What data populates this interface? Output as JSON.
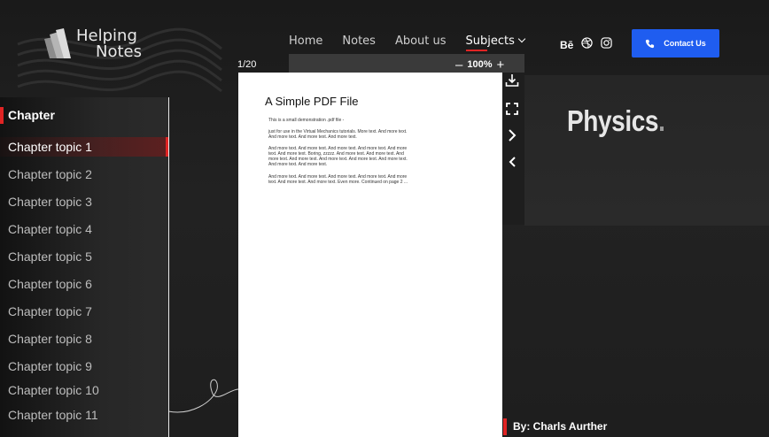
{
  "logo": {
    "line1": "Helping",
    "line2": "Notes"
  },
  "nav": {
    "items": [
      {
        "label": "Home"
      },
      {
        "label": "Notes"
      },
      {
        "label": "About us"
      },
      {
        "label": "Subjects"
      }
    ]
  },
  "social": {
    "behance": "Bē",
    "icons": [
      "behance-icon",
      "dribbble-icon",
      "instagram-icon"
    ]
  },
  "contact": {
    "label": "Contact Us"
  },
  "sidebar": {
    "title": "Chapter",
    "items": [
      {
        "label": "Chapter topic 1"
      },
      {
        "label": "Chapter topic 2"
      },
      {
        "label": "Chapter topic 3"
      },
      {
        "label": "Chapter topic 4"
      },
      {
        "label": "Chapter topic 5"
      },
      {
        "label": "Chapter topic 6"
      },
      {
        "label": "Chapter topic 7"
      },
      {
        "label": "Chapter topic 8"
      },
      {
        "label": "Chapter topic 9"
      },
      {
        "label": "Chapter topic 10"
      },
      {
        "label": "Chapter topic 11"
      }
    ]
  },
  "viewer": {
    "page_indicator": "1/20",
    "zoom_minus": "–",
    "zoom": "100%",
    "zoom_plus": "+",
    "tools": [
      "download-icon",
      "fullscreen-icon",
      "next-icon",
      "previous-icon"
    ]
  },
  "pdf": {
    "title": "A Simple PDF File",
    "p1": "This is a small demonstration .pdf file -",
    "p2": "just for use in the Virtual Mechanics tutorials. More text. And more text. And more text. And more text. And more text.",
    "p3": "And more text. And more text. And more text. And more text. And more text. And more text. Boring, zzzzz. And more text. And more text. And more text. And more text. And more text. And more text. And more text. And more text. And more text.",
    "p4": "And more text. And more text. And more text. And more text. And more text. And more text. And more text. Even more. Continued on page 2 ..."
  },
  "subject": {
    "name": "Physics",
    "dot": "."
  },
  "author": {
    "label": "By: Charls Aurther"
  },
  "colors": {
    "accent_red": "#e02424",
    "button_blue": "#1f5df0",
    "background": "#1c1c1c"
  }
}
